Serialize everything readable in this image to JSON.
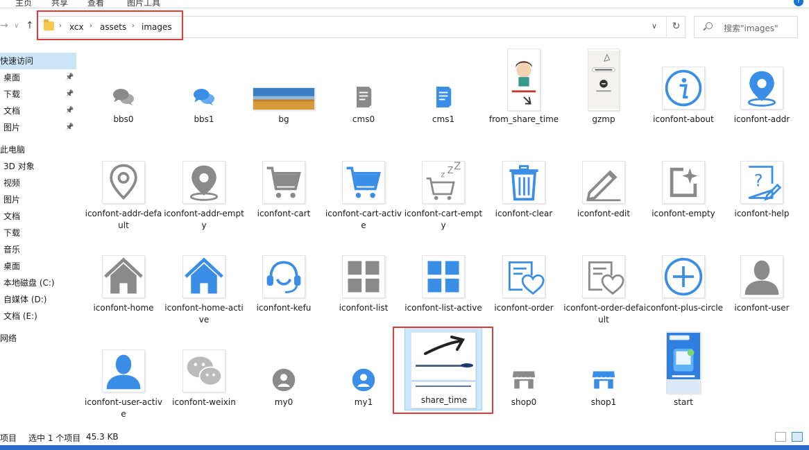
{
  "ribbon": {
    "tabs": [
      "主页",
      "共享",
      "查看",
      "图片工具"
    ],
    "help_icon": "help-icon"
  },
  "address": {
    "crumbs": [
      "xcx",
      "assets",
      "images"
    ],
    "search_placeholder": "搜索\"images\""
  },
  "sidebar": {
    "items": [
      {
        "label": "快速访问",
        "pinned": false,
        "selected": true
      },
      {
        "label": "桌面",
        "pinned": true,
        "selected": false
      },
      {
        "label": "下载",
        "pinned": true,
        "selected": false
      },
      {
        "label": "文档",
        "pinned": true,
        "selected": false
      },
      {
        "label": "图片",
        "pinned": true,
        "selected": false
      },
      {
        "label": "此电脑",
        "pinned": false,
        "selected": false
      },
      {
        "label": "3D 对象",
        "pinned": false,
        "selected": false
      },
      {
        "label": "视频",
        "pinned": false,
        "selected": false
      },
      {
        "label": "图片",
        "pinned": false,
        "selected": false
      },
      {
        "label": "文档",
        "pinned": false,
        "selected": false
      },
      {
        "label": "下载",
        "pinned": false,
        "selected": false
      },
      {
        "label": "音乐",
        "pinned": false,
        "selected": false
      },
      {
        "label": "桌面",
        "pinned": false,
        "selected": false
      },
      {
        "label": "本地磁盘 (C:)",
        "pinned": false,
        "selected": false
      },
      {
        "label": "自媒体 (D:)",
        "pinned": false,
        "selected": false
      },
      {
        "label": "文档 (E:)",
        "pinned": false,
        "selected": false
      },
      {
        "label": "网络",
        "pinned": false,
        "selected": false
      }
    ]
  },
  "files": [
    {
      "name": "bbs0",
      "icon": "chat-bubbles-icon",
      "color": "#8a8a8a"
    },
    {
      "name": "bbs1",
      "icon": "chat-bubbles-icon",
      "color": "#3a8ee6"
    },
    {
      "name": "bg",
      "icon": "landscape-photo",
      "color": "#d99a3a"
    },
    {
      "name": "cms0",
      "icon": "document-icon",
      "color": "#8a8a8a"
    },
    {
      "name": "cms1",
      "icon": "document-icon",
      "color": "#3a8ee6"
    },
    {
      "name": "from_share_time",
      "icon": "cartoon-poster",
      "color": "#c0392b"
    },
    {
      "name": "gzmp",
      "icon": "qr-poster",
      "color": "#555555"
    },
    {
      "name": "iconfont-about",
      "icon": "info-circle-icon",
      "color": "#3a8ee6"
    },
    {
      "name": "iconfont-addr",
      "icon": "location-pin-icon",
      "color": "#3a8ee6"
    },
    {
      "name": "iconfont-addr-default",
      "icon": "location-pin-outline-icon",
      "color": "#8a8a8a"
    },
    {
      "name": "iconfont-addr-empty",
      "icon": "location-pin-icon",
      "color": "#8a8a8a"
    },
    {
      "name": "iconfont-cart",
      "icon": "cart-icon",
      "color": "#8a8a8a"
    },
    {
      "name": "iconfont-cart-active",
      "icon": "cart-icon",
      "color": "#3a8ee6"
    },
    {
      "name": "iconfont-cart-empty",
      "icon": "cart-empty-icon",
      "color": "#8a8a8a"
    },
    {
      "name": "iconfont-clear",
      "icon": "trash-icon",
      "color": "#3a8ee6"
    },
    {
      "name": "iconfont-edit",
      "icon": "pencil-icon",
      "color": "#8a8a8a"
    },
    {
      "name": "iconfont-empty",
      "icon": "empty-box-icon",
      "color": "#8a8a8a"
    },
    {
      "name": "iconfont-help",
      "icon": "help-doc-icon",
      "color": "#3a8ee6"
    },
    {
      "name": "iconfont-home",
      "icon": "home-icon",
      "color": "#8a8a8a"
    },
    {
      "name": "iconfont-home-active",
      "icon": "home-icon",
      "color": "#3a8ee6"
    },
    {
      "name": "iconfont-kefu",
      "icon": "headset-icon",
      "color": "#3a8ee6"
    },
    {
      "name": "iconfont-list",
      "icon": "grid-icon",
      "color": "#8a8a8a"
    },
    {
      "name": "iconfont-list-active",
      "icon": "grid-icon",
      "color": "#3a8ee6"
    },
    {
      "name": "iconfont-order",
      "icon": "order-heart-icon",
      "color": "#3a8ee6"
    },
    {
      "name": "iconfont-order-default",
      "icon": "order-heart-icon",
      "color": "#8a8a8a"
    },
    {
      "name": "iconfont-plus-circle",
      "icon": "plus-circle-icon",
      "color": "#3a8ee6"
    },
    {
      "name": "iconfont-user",
      "icon": "user-icon",
      "color": "#8a8a8a"
    },
    {
      "name": "iconfont-user-active",
      "icon": "user-icon",
      "color": "#3a8ee6"
    },
    {
      "name": "iconfont-weixin",
      "icon": "wechat-icon",
      "color": "#bbbbbb"
    },
    {
      "name": "my0",
      "icon": "avatar-circle-icon",
      "color": "#8a8a8a"
    },
    {
      "name": "my1",
      "icon": "avatar-circle-icon",
      "color": "#3a8ee6"
    },
    {
      "name": "share_time",
      "icon": "share-arrow-poster",
      "color": "#1f3b6e",
      "selected": true
    },
    {
      "name": "shop0",
      "icon": "shop-icon",
      "color": "#8a8a8a"
    },
    {
      "name": "shop1",
      "icon": "shop-icon",
      "color": "#3a8ee6"
    },
    {
      "name": "start",
      "icon": "start-splash-poster",
      "color": "#2f7fe0"
    }
  ],
  "status": {
    "count": "项目",
    "selected": "选中 1 个项目",
    "size": "45.3 KB"
  }
}
